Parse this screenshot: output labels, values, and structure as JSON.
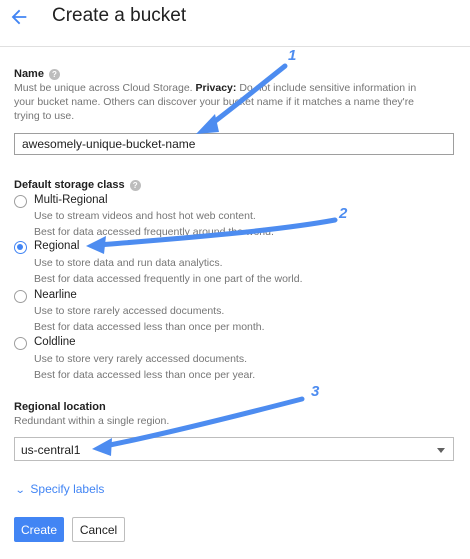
{
  "header": {
    "back_icon": "arrow-back-icon",
    "title": "Create a bucket"
  },
  "name_section": {
    "label": "Name",
    "help_icon": "help-icon",
    "desc_line1": "Must be unique across Cloud Storage.",
    "desc_privacy": "Privacy:",
    "desc_line1_rest": "Do not include sensitive information in",
    "desc_line2": "your bucket name. Others can discover your bucket name if it matches a name they're",
    "desc_line3": "trying to use.",
    "input_value": "awesomely-unique-bucket-name"
  },
  "storage_class": {
    "label": "Default storage class",
    "help_icon": "help-icon",
    "options": [
      {
        "label": "Multi-Regional",
        "checked": false,
        "desc1": "Use to stream videos and host hot web content.",
        "desc2": "Best for data accessed frequently around the world."
      },
      {
        "label": "Regional",
        "checked": true,
        "desc1": "Use to store data and run data analytics.",
        "desc2": "Best for data accessed frequently in one part of the world."
      },
      {
        "label": "Nearline",
        "checked": false,
        "desc1": "Use to store rarely accessed documents.",
        "desc2": "Best for data accessed less than once per month."
      },
      {
        "label": "Coldline",
        "checked": false,
        "desc1": "Use to store very rarely accessed documents.",
        "desc2": "Best for data accessed less than once per year."
      }
    ]
  },
  "location": {
    "label": "Regional location",
    "desc": "Redundant within a single region.",
    "selected": "us-central1",
    "caret_icon": "dropdown-caret-icon"
  },
  "labels_link": {
    "icon": "chevron-down-icon",
    "text": "Specify labels"
  },
  "actions": {
    "create": "Create",
    "cancel": "Cancel"
  },
  "annotations": {
    "color": "#4d8cf0",
    "step1": "1",
    "step2": "2",
    "step3": "3"
  },
  "colors": {
    "accent": "#4285f4",
    "text": "#212121",
    "muted": "#757575"
  }
}
